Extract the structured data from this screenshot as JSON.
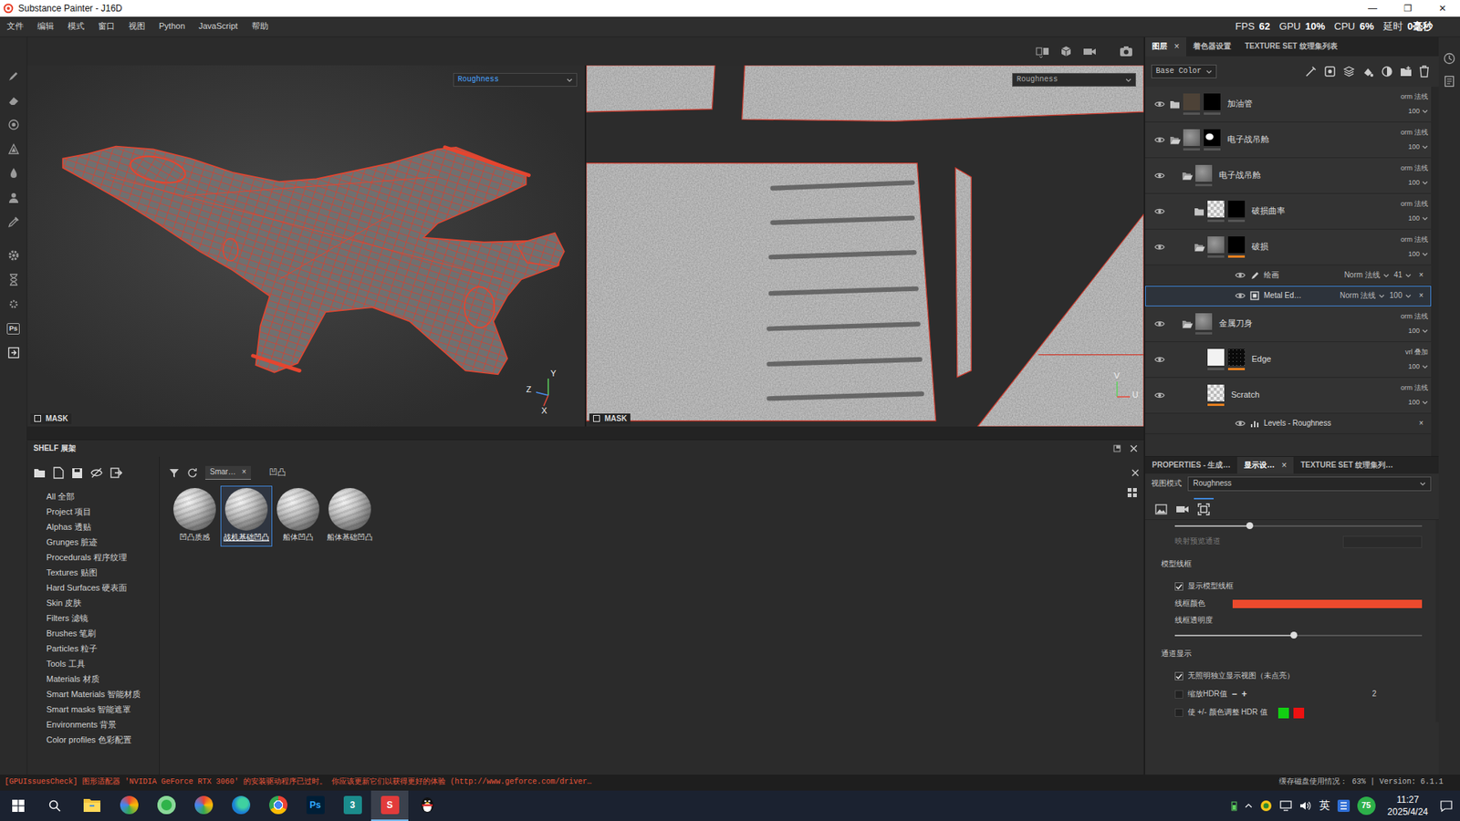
{
  "window": {
    "title": "Substance Painter - J16D",
    "controls": [
      "—",
      "❐",
      "✕"
    ]
  },
  "menu": [
    "文件",
    "编辑",
    "模式",
    "窗口",
    "视图",
    "Python",
    "JavaScript",
    "帮助"
  ],
  "perf": [
    {
      "label": "FPS",
      "value": "62"
    },
    {
      "label": "GPU",
      "value": "10%"
    },
    {
      "label": "CPU",
      "value": "6%"
    },
    {
      "label": "延时",
      "value": "0毫秒"
    }
  ],
  "left_tools": [
    {
      "kind": "brush"
    },
    {
      "kind": "eraser"
    },
    {
      "kind": "projection"
    },
    {
      "kind": "polyfill"
    },
    {
      "kind": "smudge"
    },
    {
      "kind": "clone"
    },
    {
      "kind": "picker"
    },
    {
      "kind": "bake"
    },
    {
      "kind": "timer"
    },
    {
      "kind": "settings"
    },
    {
      "kind": "photoshop",
      "label": "Ps"
    },
    {
      "kind": "export"
    }
  ],
  "viewports": [
    {
      "kind": "3d",
      "active": true,
      "channel": "Roughness",
      "mask": "MASK",
      "axes": [
        "Y",
        "Z",
        "X"
      ]
    },
    {
      "kind": "uv",
      "active": false,
      "channel": "Roughness",
      "mask": "MASK",
      "axes": [
        "V",
        "U"
      ]
    }
  ],
  "layers_panel": {
    "tabs": [
      {
        "label": "图层",
        "selected": true,
        "close": "×"
      },
      {
        "label": "着色器设置",
        "selected": false
      },
      {
        "label": "TEXTURE SET 纹理集列表",
        "selected": false
      }
    ],
    "channel": "Base Color",
    "layers": [
      {
        "name": "加油管",
        "kind": "folder",
        "depth": 0,
        "expanded": false,
        "visible": true,
        "thumb": "dark",
        "mask": "black",
        "flag": "none",
        "blend": "orm 法线",
        "opacity": "100",
        "effects": []
      },
      {
        "name": "电子战吊舱",
        "kind": "folder",
        "depth": 0,
        "expanded": true,
        "visible": true,
        "thumb": "grey",
        "mask": "blackwhite",
        "flag": "none",
        "blend": "orm 法线",
        "opacity": "100",
        "effects": []
      },
      {
        "name": "电子战吊舱",
        "kind": "folder",
        "depth": 1,
        "expanded": true,
        "visible": true,
        "thumb": "grey",
        "mask": "none",
        "flag": "none",
        "blend": "orm 法线",
        "opacity": "100",
        "effects": []
      },
      {
        "name": "破损曲率",
        "kind": "folder",
        "depth": 2,
        "expanded": false,
        "visible": true,
        "thumb": "checker",
        "mask": "black",
        "flag": "none",
        "blend": "orm 法线",
        "opacity": "100",
        "effects": []
      },
      {
        "name": "破损",
        "kind": "folder",
        "depth": 2,
        "expanded": true,
        "visible": true,
        "thumb": "grey",
        "mask": "black",
        "flag": "mask",
        "blend": "orm 法线",
        "opacity": "100",
        "effects": [
          {
            "kind": "paint",
            "name": "绘画",
            "blend": "Norm 法线",
            "opacity": "41",
            "close": "×",
            "visible": true,
            "selected": false
          },
          {
            "kind": "fill",
            "name": "Metal Ed…",
            "blend": "Norm 法线",
            "opacity": "100",
            "close": "×",
            "visible": true,
            "selected": true
          }
        ]
      },
      {
        "name": "金属刀身",
        "kind": "folder",
        "depth": 1,
        "expanded": true,
        "visible": true,
        "thumb": "grey",
        "mask": "none",
        "flag": "none",
        "blend": "orm 法线",
        "opacity": "100",
        "effects": []
      },
      {
        "name": "Edge",
        "kind": "fill",
        "depth": 2,
        "expanded": false,
        "visible": true,
        "thumb": "white",
        "mask": "speckle",
        "flag": "mask",
        "blend": "vrl 叠加",
        "opacity": "100",
        "effects": []
      },
      {
        "name": "Scratch",
        "kind": "fill",
        "depth": 2,
        "expanded": false,
        "visible": true,
        "thumb": "checker",
        "mask": "none",
        "flag": "thumb",
        "blend": "orm 法线",
        "opacity": "100",
        "effects": [
          {
            "kind": "levels",
            "name": "Levels - Roughness",
            "close": "×",
            "visible": true,
            "selected": false
          }
        ]
      }
    ]
  },
  "properties": {
    "tabs": [
      {
        "label": "PROPERTIES - 生成…",
        "selected": false
      },
      {
        "label": "显示设…",
        "selected": true,
        "close": "×"
      },
      {
        "label": "TEXTURE SET 纹理集列…",
        "selected": false
      }
    ],
    "view_mode": {
      "label": "视图模式",
      "value": "Roughness"
    },
    "view_tabs": [
      {
        "kind": "image",
        "selected": false
      },
      {
        "kind": "camera",
        "selected": false
      },
      {
        "kind": "display",
        "selected": true
      }
    ],
    "rows": [
      {
        "kind": "slider",
        "level": 0.3
      },
      {
        "kind": "field",
        "label": "映射预览通道",
        "disabled": true
      },
      {
        "kind": "section",
        "label": "模型线框"
      },
      {
        "kind": "check",
        "label": "显示模型线框",
        "checked": true
      },
      {
        "kind": "color",
        "label": "线框颜色",
        "color": "#ec4a2d"
      },
      {
        "kind": "label",
        "label": "线框透明度"
      },
      {
        "kind": "slider",
        "level": 0.48
      },
      {
        "kind": "section",
        "label": "通道显示"
      },
      {
        "kind": "check",
        "label": "无照明独立显示视图（未点亮）",
        "checked": true
      },
      {
        "kind": "stepper",
        "label": "缩放HDR值",
        "checked": false,
        "minus": "−",
        "plus": "+",
        "value": "2"
      },
      {
        "kind": "swatches",
        "label": "使 +/- 颜色调整 HDR 值",
        "checked": false,
        "swatches": [
          {
            "color": "#12d012"
          },
          {
            "color": "#ee1111"
          }
        ]
      }
    ]
  },
  "shelf": {
    "title": "SHELF 展架",
    "categories": [
      "All 全部",
      "Project 项目",
      "Alphas 透贴",
      "Grunges 脏迹",
      "Procedurals 程序纹理",
      "Textures 贴图",
      "Hard Surfaces 硬表面",
      "Skin 皮肤",
      "Filters 滤镜",
      "Brushes 笔刷",
      "Particles 粒子",
      "Tools 工具",
      "Materials 材质",
      "Smart Materials 智能材质",
      "Smart masks 智能遮罩",
      "Environments 背景",
      "Color profiles 色彩配置"
    ],
    "filter": {
      "chip": "Smar…",
      "chip_close": "×",
      "query": "凹凸"
    },
    "items": [
      {
        "label": "凹凸质感",
        "selected": false
      },
      {
        "label": "战机基础凹凸",
        "selected": true
      },
      {
        "label": "船体凹凸",
        "selected": false
      },
      {
        "label": "船体基础凹凸",
        "selected": false
      }
    ]
  },
  "status_bar": {
    "message": "[GPUIssuesCheck] 图形适配器 'NVIDIA GeForce RTX 3060' 的安装驱动程序已过时。 你应该更新它们以获得更好的体验 (http://www.geforce.com/driver…",
    "disk": "缓存磁盘使用情况： 63% | Version: 6.1.1"
  },
  "taskbar": {
    "apps": [
      {
        "kind": "explorer",
        "active": false
      },
      {
        "kind": "ball",
        "active": false
      },
      {
        "kind": "green",
        "active": false
      },
      {
        "kind": "ball",
        "active": false
      },
      {
        "kind": "edge",
        "active": false
      },
      {
        "kind": "chrome",
        "active": false
      },
      {
        "kind": "ps",
        "label": "Ps",
        "active": false
      },
      {
        "kind": "max",
        "label": "3",
        "active": false
      },
      {
        "kind": "painter",
        "label": "S",
        "active": true
      },
      {
        "kind": "qq",
        "active": false
      }
    ],
    "tray": {
      "lang": "英",
      "badge": "75",
      "time": "11:27",
      "date": "2025/4/24"
    }
  }
}
